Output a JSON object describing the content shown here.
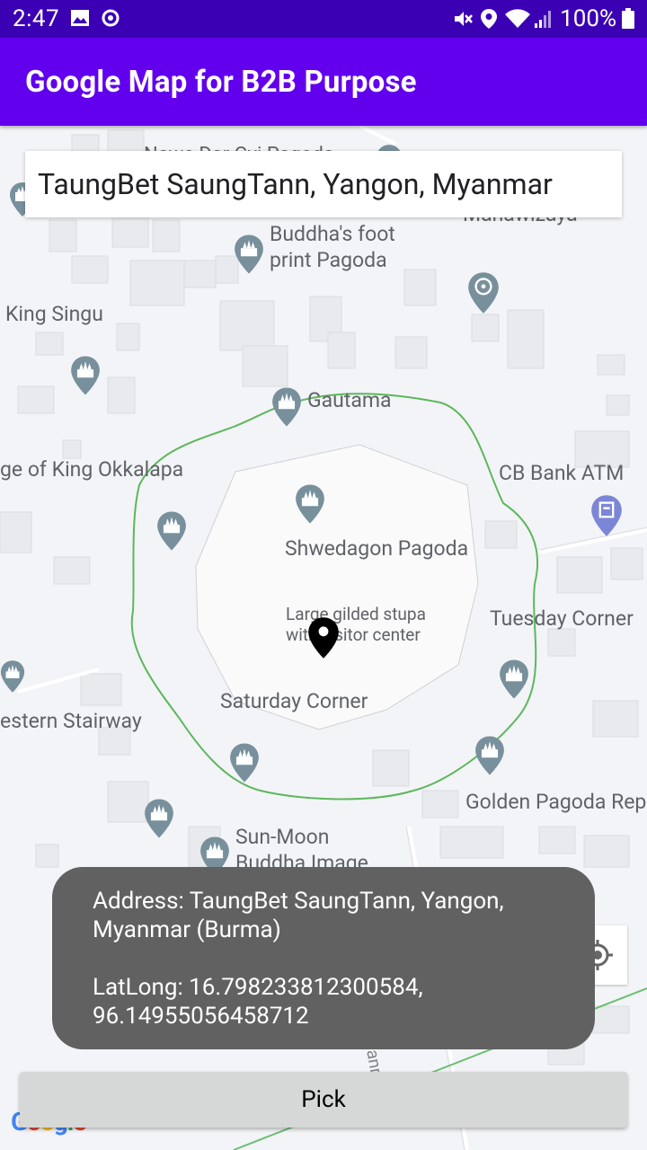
{
  "status_bar": {
    "time": "2:47",
    "battery": "100%",
    "icons": [
      "image-icon",
      "record-icon",
      "mute-icon",
      "location-icon",
      "wifi-icon",
      "signal-icon",
      "battery-icon"
    ]
  },
  "app_bar": {
    "title": "Google Map for B2B Purpose"
  },
  "search": {
    "value": "TaungBet SaungTann, Yangon, Myanmar"
  },
  "map": {
    "labels": {
      "buddha_foot_1": "Buddha's foot",
      "buddha_foot_2": "print Pagoda",
      "king_singu": "King Singu",
      "gautama": "Gautama",
      "okkalapa": "ge of King Okkalapa",
      "cb_bank": "CB Bank ATM",
      "shwedagon": "Shwedagon Pagoda",
      "stupa_1": "Large gilded stupa",
      "stupa_2": "with visitor center",
      "tuesday": "Tuesday Corner",
      "saturday": "Saturday Corner",
      "western": "estern Stairway",
      "golden": "Golden Pagoda Rep",
      "sunmoon_1": "Sun-Moon",
      "sunmoon_2": "Buddha Image",
      "road": "TaungBet SaungTann",
      "top_partial": "Mahawizaya"
    }
  },
  "toast": {
    "address": "Address: TaungBet SaungTann, Yangon, Myanmar (Burma)",
    "latlong": "LatLong: 16.798233812300584, 96.14955056458712"
  },
  "pick_button": {
    "label": "Pick"
  },
  "google_logo": "Google",
  "colors": {
    "app_bar": "#6200ee",
    "status_bar": "#3c00b4",
    "toast_bg": "#616161",
    "pick_bg": "#d6d7d7",
    "boundary": "#5cb85c",
    "pin_blue": "#78909c"
  }
}
